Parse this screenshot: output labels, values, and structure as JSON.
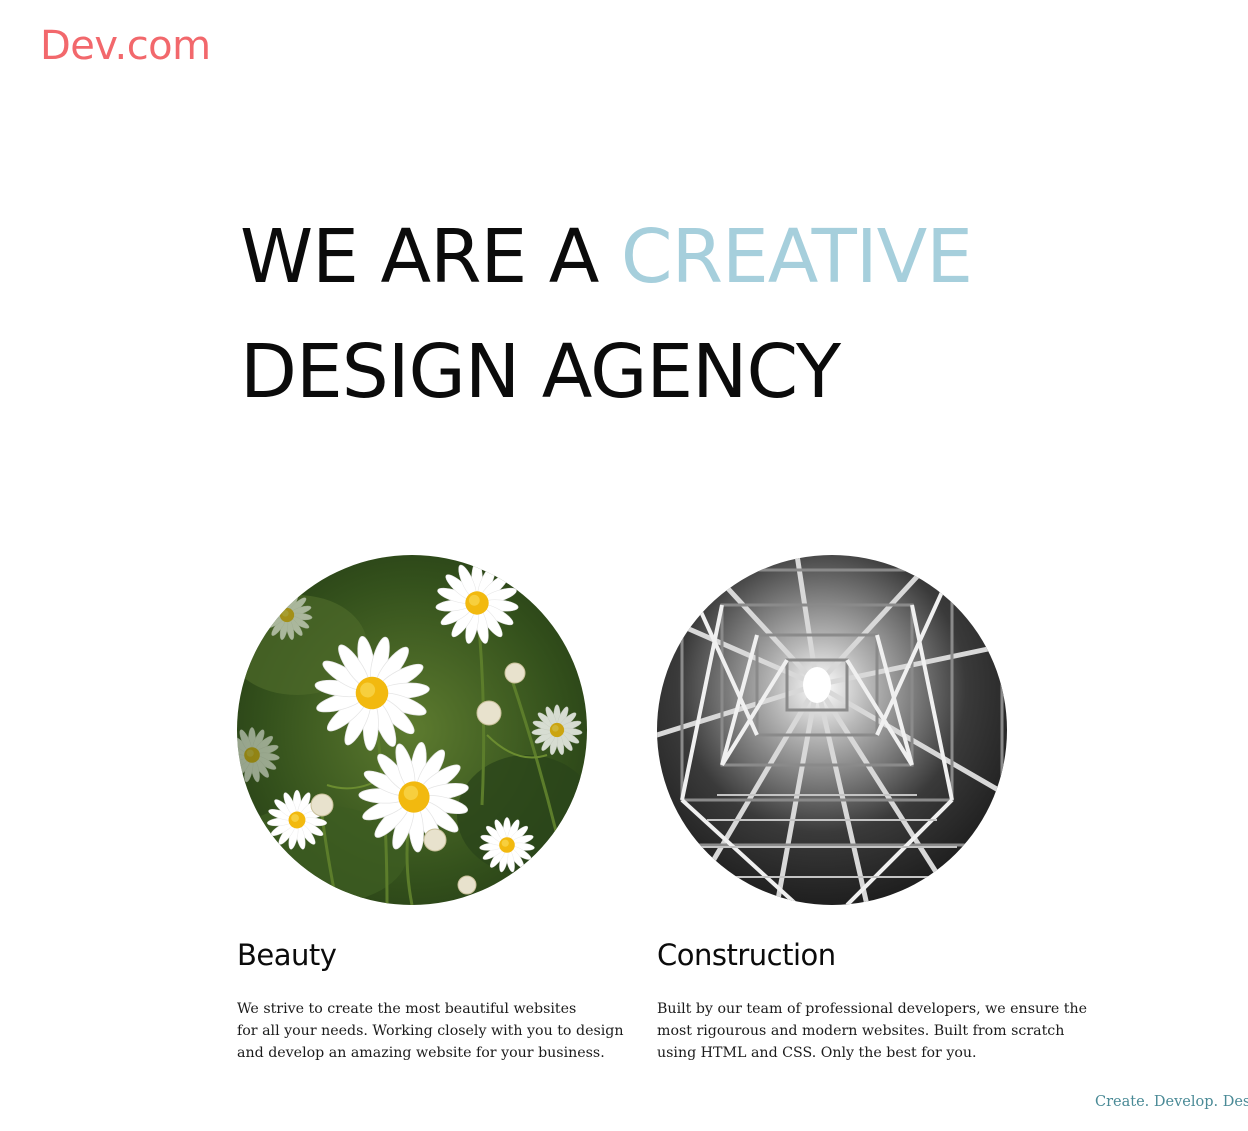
{
  "brand": {
    "logo_text": "Dev.com",
    "accent_color": "#f2686c"
  },
  "hero": {
    "line1_prefix": "WE ARE A ",
    "line1_accent": "CREATIVE",
    "line2": "DESIGN AGENCY",
    "accent_color": "#a6cfdc"
  },
  "cards": [
    {
      "title": "Beauty",
      "image_subject": "white daisy flowers",
      "description_lines": [
        "We strive to create the most beautiful websites",
        "for all your needs. Working closely with you to design",
        "and develop an amazing website for your business."
      ]
    },
    {
      "title": "Construction",
      "image_subject": "steel lattice structure",
      "description_lines": [
        "Built by our team of professional developers, we ensure the",
        "most rigourous and modern websites. Built from scratch",
        "using HTML and CSS. Only the best for you."
      ]
    }
  ],
  "footer": {
    "tagline": "Create. Develop. Desig"
  }
}
